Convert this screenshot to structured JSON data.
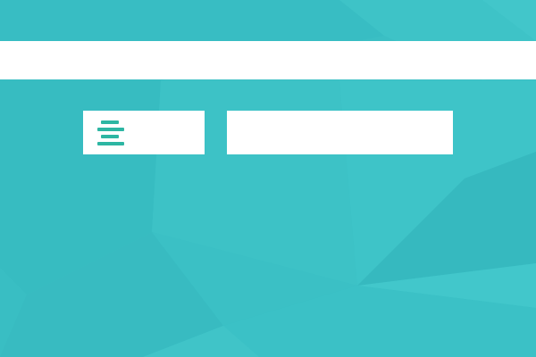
{
  "theme": {
    "background": "#3bbfc4",
    "accent": "#2db6a3",
    "surface": "#ffffff"
  },
  "menu": {
    "icon": "hamburger-menu-icon"
  },
  "search": {
    "value": "",
    "placeholder": ""
  }
}
